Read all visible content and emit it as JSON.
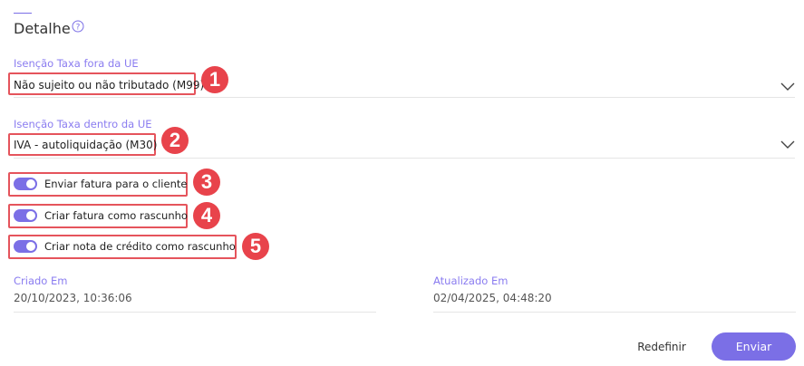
{
  "section": {
    "title": "Detalhe",
    "help_icon": "question-circle-icon"
  },
  "fields": {
    "outside_eu": {
      "label": "Isenção Taxa fora da UE",
      "value": "Não sujeito ou não tributado (M99)"
    },
    "inside_eu": {
      "label": "Isenção Taxa dentro da UE",
      "value": "IVA - autoliquidação (M30)"
    }
  },
  "toggles": [
    {
      "label": "Enviar fatura para o cliente",
      "on": true
    },
    {
      "label": "Criar fatura como rascunho",
      "on": true
    },
    {
      "label": "Criar nota de crédito como rascunho",
      "on": true
    }
  ],
  "meta": {
    "created": {
      "label": "Criado Em",
      "value": "20/10/2023, 10:36:06"
    },
    "updated": {
      "label": "Atualizado Em",
      "value": "02/04/2025, 04:48:20"
    }
  },
  "badges": [
    "1",
    "2",
    "3",
    "4",
    "5"
  ],
  "actions": {
    "reset": "Redefinir",
    "send": "Enviar"
  },
  "colors": {
    "accent": "#7b6fe6",
    "highlight": "#e5545c",
    "badge": "#e8434b"
  }
}
